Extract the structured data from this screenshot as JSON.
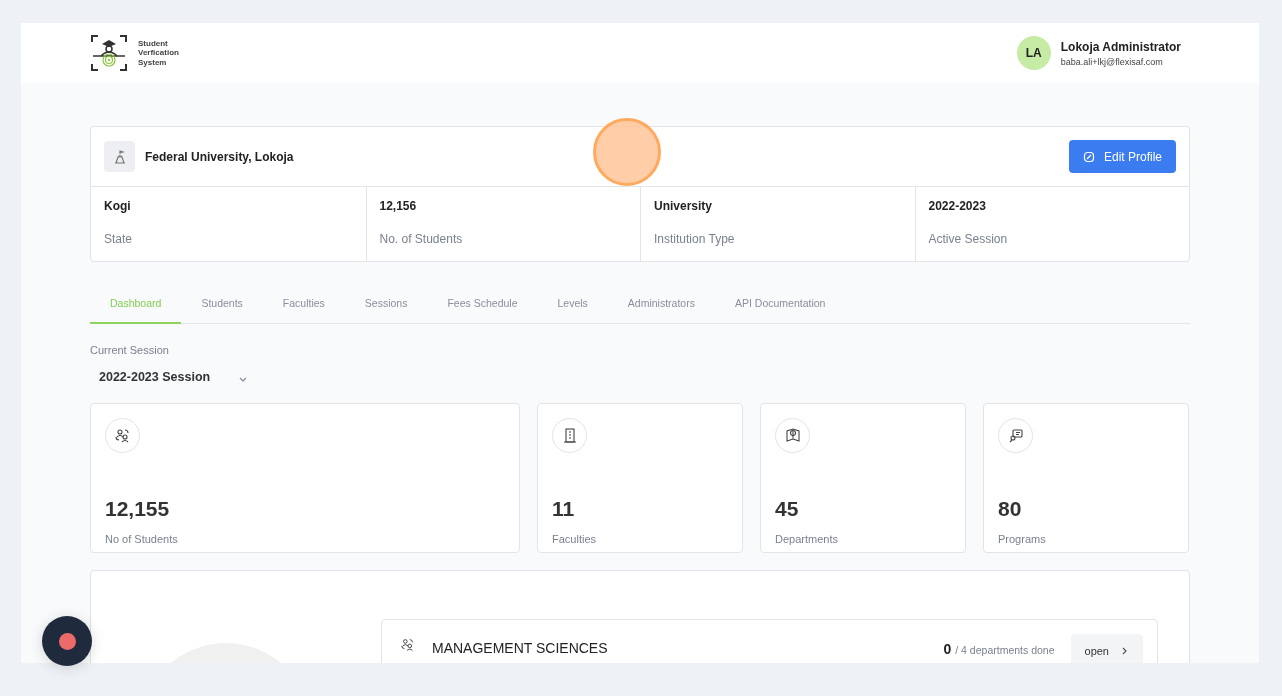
{
  "header": {
    "logo_text": [
      "Student",
      "Verfication",
      "System"
    ],
    "user": {
      "initials": "LA",
      "name": "Lokoja Administrator",
      "email": "baba.ali+lkj@flexisaf.com"
    }
  },
  "institution": {
    "name": "Federal University, Lokoja",
    "edit_button": "Edit Profile",
    "facts": [
      {
        "value": "Kogi",
        "label": "State"
      },
      {
        "value": "12,156",
        "label": "No. of Students"
      },
      {
        "value": "University",
        "label": "Institution Type"
      },
      {
        "value": "2022-2023",
        "label": "Active Session"
      }
    ]
  },
  "tabs": [
    {
      "label": "Dashboard",
      "selected": true
    },
    {
      "label": "Students",
      "selected": false
    },
    {
      "label": "Faculties",
      "selected": false
    },
    {
      "label": "Sessions",
      "selected": false
    },
    {
      "label": "Fees Schedule",
      "selected": false
    },
    {
      "label": "Levels",
      "selected": false
    },
    {
      "label": "Administrators",
      "selected": false
    },
    {
      "label": "API Documentation",
      "selected": false
    }
  ],
  "session": {
    "label": "Current Session",
    "value": "2022-2023 Session"
  },
  "stats": [
    {
      "kind": "students",
      "value": "12,155",
      "label": "No of Students"
    },
    {
      "kind": "faculties",
      "value": "11",
      "label": "Faculties"
    },
    {
      "kind": "departments",
      "value": "45",
      "label": "Departments"
    },
    {
      "kind": "programs",
      "value": "80",
      "label": "Programs"
    }
  ],
  "faculties": [
    {
      "name": "MANAGEMENT SCIENCES",
      "done": "0",
      "progress": "/ 4 departments done",
      "button": "open"
    }
  ]
}
